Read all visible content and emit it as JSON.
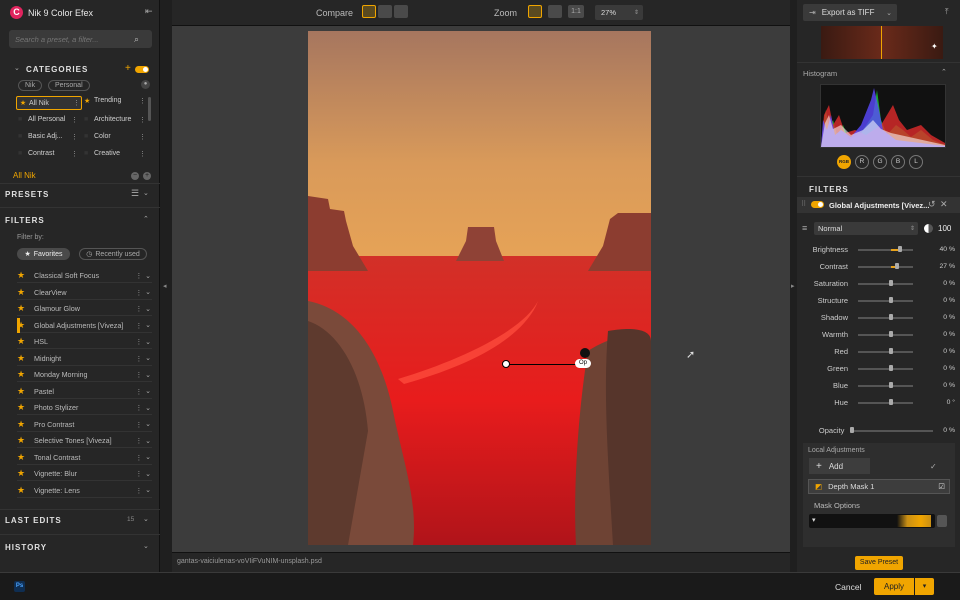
{
  "app": {
    "title": "Nik 9 Color Efex"
  },
  "search": {
    "placeholder": "Search a preset, a filter..."
  },
  "categories": {
    "header": "CATEGORIES",
    "tabs": [
      "Nik",
      "Personal"
    ],
    "items": [
      "All Nik",
      "Trending",
      "All Personal",
      "Architecture",
      "Basic Adj...",
      "Color",
      "Contrast",
      "Creative"
    ],
    "current": "All Nik"
  },
  "presets": {
    "header": "PRESETS"
  },
  "filters": {
    "header": "FILTERS",
    "filter_by": "Filter by:",
    "favorites": "Favorites",
    "recently_used": "Recently used",
    "items": [
      "Classical Soft Focus",
      "ClearView",
      "Glamour Glow",
      "Global Adjustments [Viveza]",
      "HSL",
      "Midnight",
      "Monday Morning",
      "Pastel",
      "Photo Stylizer",
      "Pro Contrast",
      "Selective Tones [Viveza]",
      "Tonal Contrast",
      "Vignette: Blur",
      "Vignette: Lens"
    ]
  },
  "last_edits": {
    "header": "LAST EDITS",
    "count": "15"
  },
  "history": {
    "header": "HISTORY"
  },
  "toolbar": {
    "compare": "Compare",
    "zoom": "Zoom",
    "one_to_one": "1:1",
    "zoom_value": "27%"
  },
  "canvas": {
    "filename": "gantas-vaiciulenas-voVIiFVuNIM-unsplash.psd",
    "point_label": "Op"
  },
  "right": {
    "export": "Export as TIFF",
    "histogram": "Histogram",
    "channels": [
      "RGB",
      "R",
      "G",
      "B",
      "L"
    ],
    "filters_header": "FILTERS",
    "filter_name": "Global Adjustments [Vivez...",
    "blend_mode": "Normal",
    "opacity_val": "100",
    "sliders": [
      {
        "label": "Brightness",
        "value": "40 %",
        "v": 40
      },
      {
        "label": "Contrast",
        "value": "27 %",
        "v": 27
      },
      {
        "label": "Saturation",
        "value": "0 %",
        "v": 0
      },
      {
        "label": "Structure",
        "value": "0 %",
        "v": 0
      },
      {
        "label": "Shadow",
        "value": "0 %",
        "v": 0
      },
      {
        "label": "Warmth",
        "value": "0 %",
        "v": 0
      },
      {
        "label": "Red",
        "value": "0 %",
        "v": 0
      },
      {
        "label": "Green",
        "value": "0 %",
        "v": 0
      },
      {
        "label": "Blue",
        "value": "0 %",
        "v": 0
      },
      {
        "label": "Hue",
        "value": "0 °",
        "v": 0
      }
    ],
    "opacity_label": "Opacity",
    "opacity_value": "0 %",
    "local_adjustments": "Local Adjustments",
    "add": "Add",
    "depth_mask": "Depth Mask 1",
    "mask_options": "Mask Options",
    "save_preset": "Save Preset"
  },
  "bottom": {
    "ps": "Ps",
    "cancel": "Cancel",
    "apply": "Apply"
  },
  "colors": {
    "accent": "#f0a500",
    "mask_red": "#e0141a"
  }
}
